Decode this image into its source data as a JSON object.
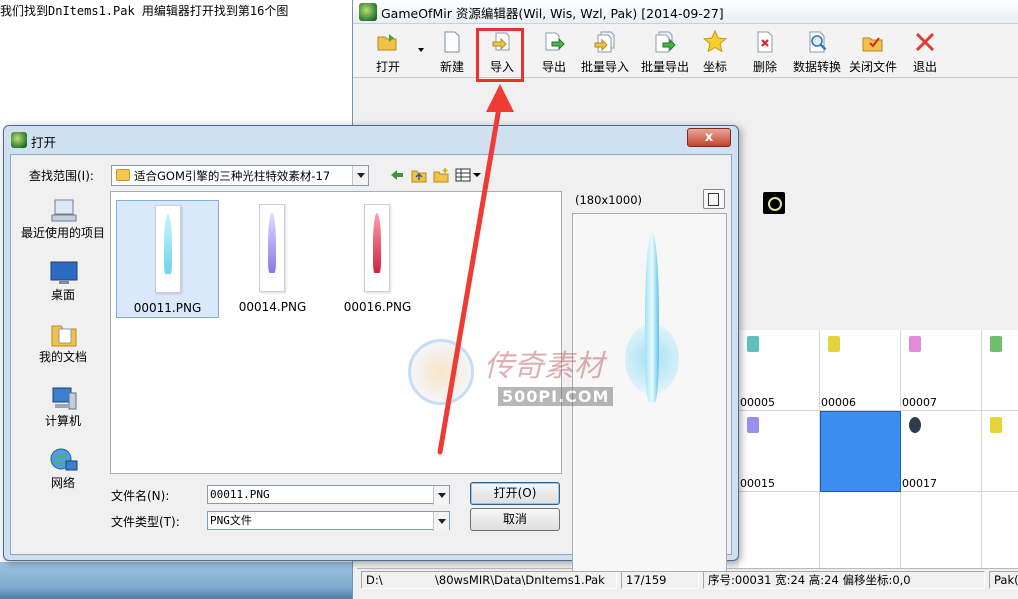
{
  "background": {
    "text": "我们找到DnItems1.Pak 用编辑器打开找到第16个图"
  },
  "editor": {
    "title": "GameOfMir 资源编辑器(Wil, Wis, Wzl, Pak) [2014-09-27]",
    "toolbar": [
      {
        "label": "打开",
        "icon": "open-folder-icon"
      },
      {
        "label": "新建",
        "icon": "new-file-icon"
      },
      {
        "label": "导入",
        "icon": "import-icon"
      },
      {
        "label": "导出",
        "icon": "export-icon"
      },
      {
        "label": "批量导入",
        "icon": "batch-import-icon"
      },
      {
        "label": "批量导出",
        "icon": "batch-export-icon"
      },
      {
        "label": "坐标",
        "icon": "star-icon"
      },
      {
        "label": "删除",
        "icon": "delete-icon"
      },
      {
        "label": "数据转换",
        "icon": "convert-icon"
      },
      {
        "label": "关闭文件",
        "icon": "close-file-icon"
      },
      {
        "label": "退出",
        "icon": "exit-icon"
      }
    ],
    "grid": {
      "row1": [
        "00005",
        "00006",
        "00007"
      ],
      "row2": [
        "00015",
        "",
        "00017"
      ]
    },
    "status": {
      "path_prefix": "D:\\",
      "path_suffix": "\\80wsMIR\\Data\\DnItems1.Pak",
      "count": "17/159",
      "info": "序号:00031 宽:24 高:24 偏移坐标:0,0",
      "format": "Pak(3"
    }
  },
  "dialog": {
    "title": "打开",
    "lookin_label": "查找范围(I):",
    "lookin_value": "适合GOM引擎的三种光柱特效素材-17",
    "places": [
      "最近使用的项目",
      "桌面",
      "我的文档",
      "计算机",
      "网络"
    ],
    "files": [
      {
        "name": "00011.PNG",
        "color": "#7fdcf2"
      },
      {
        "name": "00014.PNG",
        "color": "#9b86ea"
      },
      {
        "name": "00016.PNG",
        "color": "#d9334a"
      }
    ],
    "preview_size": "(180x1000)",
    "filename_label": "文件名(N):",
    "filename_value": "00011.PNG",
    "filetype_label": "文件类型(T):",
    "filetype_value": "PNG文件",
    "open_button": "打开(O)",
    "cancel_button": "取消",
    "close_glyph": "x"
  },
  "watermark": {
    "title": "传奇素材",
    "sub": "500PI.COM"
  },
  "colors": {
    "highlight": "#e8322f",
    "selected_cell": "#3b8ef0"
  }
}
